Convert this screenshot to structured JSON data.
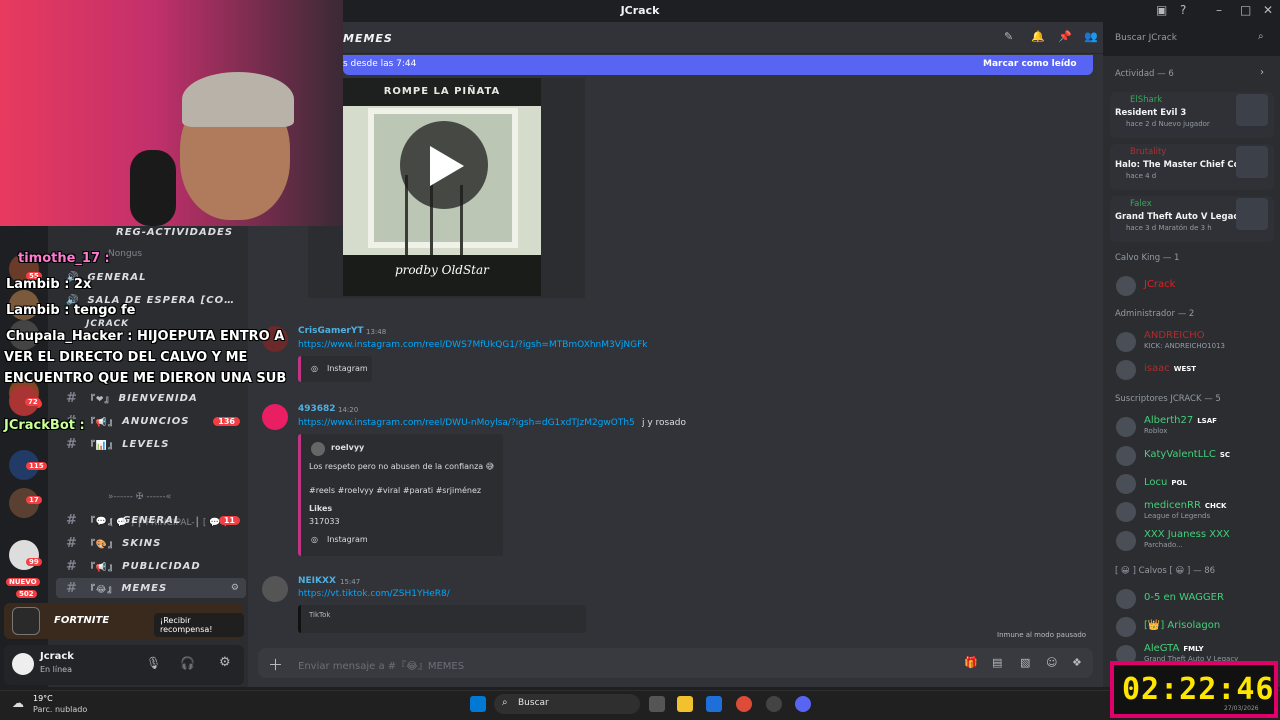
{
  "window": {
    "title": "JCrack"
  },
  "server_rail": {
    "badges": [
      "55",
      "33",
      "72",
      "115",
      "17",
      "99"
    ],
    "new_label": "NUEVO",
    "count_label": "502"
  },
  "channels": {
    "reg_actividades": "REG-ACTIVIDADES",
    "nongus_label": "Nongus",
    "general_voice": "GENERAL",
    "sala_espera": "SALA DE ESPERA [CO…",
    "jcrack_voice": "JCRACK",
    "bienvenida": "BIENVENIDA",
    "anuncios": "ANUNCIOS",
    "anuncios_badge": "136",
    "levels": "LEVELS",
    "divider": "»------ ✠ ------«",
    "principal_cat": "[ 💬 ] ┃-PRINCIPAL-┃ [ 💬 ]",
    "general": "GENERAL",
    "general_badge": "11",
    "skins": "SKINS",
    "publicidad": "PUBLICIDAD",
    "memes": "MEMES"
  },
  "banner": {
    "title": "FORTNITE",
    "button": "¡Recibir recompensa!"
  },
  "user_panel": {
    "name": "Jcrack",
    "status": "En línea"
  },
  "header": {
    "channel_title": "MEMES"
  },
  "new_messages": {
    "text": "s desde las 7:44",
    "mark_read": "Marcar como leído"
  },
  "video": {
    "caption": "ROMPE LA PIÑATA",
    "signature": "prodby OldStar"
  },
  "messages": [
    {
      "author": "CrisGamerYT",
      "time": "13:48",
      "link": "https://www.instagram.com/reel/DWS7MfUkQG1/?igsh=MTBmOXhnM3VjNGFk",
      "embed_source": "Instagram"
    },
    {
      "author": "493682",
      "time": "14:20",
      "link": "https://www.instagram.com/reel/DWU-nMoylsa/?igsh=dG1xdTJzM2gwOTh5",
      "extra": " j y rosado",
      "embed": {
        "user": "roelvyy",
        "text": "Los respeto pero no abusen de la confianza 😅",
        "tags": "#reels #roelvyy #viral #parati #srjiménez",
        "likes_label": "Likes",
        "likes": "317033",
        "source": "Instagram"
      }
    },
    {
      "author": "NEIKXX",
      "time": "15:47",
      "link": "https://vt.tiktok.com/ZSH1YHeR8/",
      "embed_source": "TikTok"
    }
  ],
  "composer": {
    "placeholder": "Enviar mensaje a #『😂』MEMES"
  },
  "paused_notice": "Inmune al modo pausado",
  "sidebar": {
    "search_placeholder": "Buscar JCrack",
    "activity_header": "Actividad — 6",
    "activities": [
      {
        "user": "ElShark",
        "game": "Resident Evil 3",
        "meta": "hace 2 d",
        "extra": "Nuevo jugador",
        "color": "#3ba55c"
      },
      {
        "user": "Brutality",
        "game": "Halo: The Master Chief Col...",
        "meta": "hace 4 d",
        "extra": "",
        "color": "#b32e2e"
      },
      {
        "user": "Falex",
        "game": "Grand Theft Auto V Legacy",
        "meta": "hace 3 d",
        "extra": "Maratón de 3 h",
        "color": "#3ba55c"
      }
    ],
    "groups": [
      {
        "header": "Calvo King — 1",
        "members": [
          {
            "name": "JCrack",
            "color": "#e02020",
            "sub": "",
            "tag": ""
          }
        ]
      },
      {
        "header": "Administrador — 2",
        "members": [
          {
            "name": "ANDREICHO",
            "color": "#b02c2c",
            "sub": "KICK: ANDREICHO1013",
            "tag": ""
          },
          {
            "name": "isaac",
            "color": "#b02c2c",
            "sub": "",
            "tag": "WEST"
          }
        ]
      },
      {
        "header": "Suscriptores JCRACK — 5",
        "members": [
          {
            "name": "Alberth27",
            "color": "#43d17a",
            "sub": "Roblox",
            "tag": "LSAF"
          },
          {
            "name": "KatyValentLLC",
            "color": "#43d17a",
            "sub": "",
            "tag": "SC"
          },
          {
            "name": "Locu",
            "color": "#43d17a",
            "sub": "",
            "tag": "POL"
          },
          {
            "name": "medicenRR",
            "color": "#43d17a",
            "sub": "League of Legends",
            "tag": "CHCK"
          },
          {
            "name": "XXX Juaness XXX",
            "color": "#43d17a",
            "sub": "Parchado...",
            "tag": ""
          }
        ]
      },
      {
        "header": "[ 😀 ] Calvos [ 😀 ] — 86",
        "members": [
          {
            "name": "0-5 en WAGGER",
            "color": "#43d17a",
            "sub": "",
            "tag": ""
          },
          {
            "name": "[👑] Arisolagon",
            "color": "#43d17a",
            "sub": "",
            "tag": ""
          },
          {
            "name": "AleGTA",
            "color": "#43d17a",
            "sub": "Grand Theft Auto V Legacy",
            "tag": "FMLY"
          }
        ]
      }
    ]
  },
  "taskbar": {
    "temp": "19°C",
    "weather": "Parc. nublado",
    "search": "Buscar"
  },
  "overlay": {
    "chat_lines": [
      "timothe_17 :",
      "Lambib : 2x",
      "Lambib : tengo fe",
      "Chupala_Hacker : HIJOEPUTA ENTRO A",
      "VER EL DIRECTO DEL CALVO Y ME",
      "ENCUENTRO QUE ME DIERON UNA SUB",
      "JCrackBot :"
    ],
    "timer": "02:22:46",
    "timer_date": "27/03/2026"
  }
}
